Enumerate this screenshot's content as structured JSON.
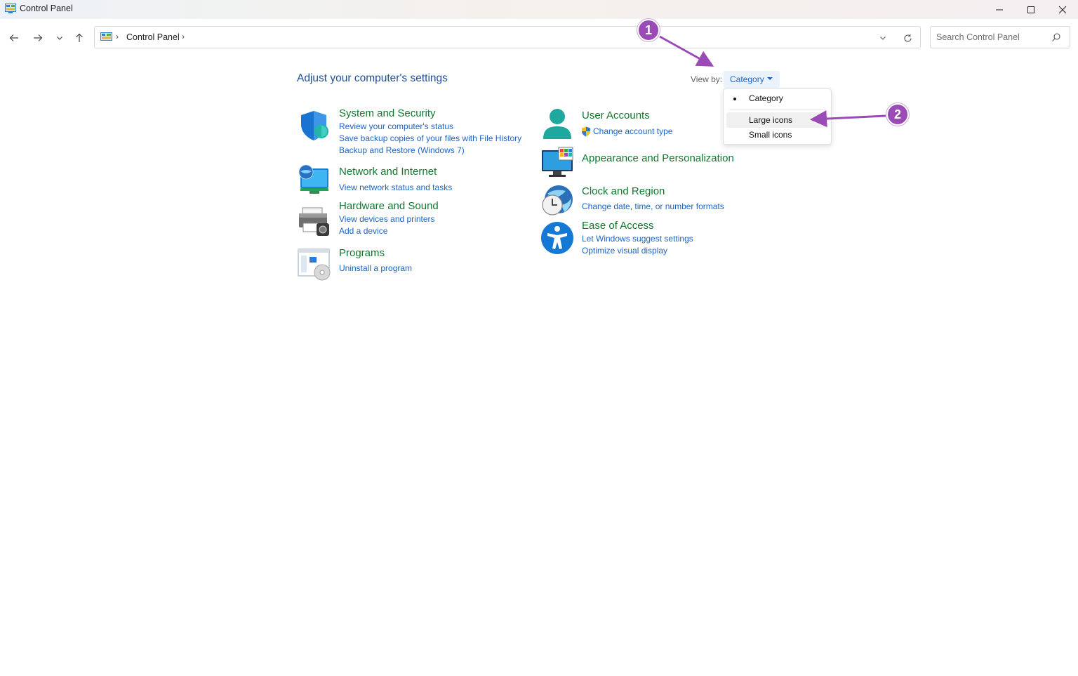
{
  "window": {
    "title": "Control Panel",
    "controls": [
      "minimize-icon",
      "maximize-icon",
      "close-icon"
    ]
  },
  "navigation": {
    "breadcrumb": [
      "Control Panel"
    ],
    "search_placeholder": "Search Control Panel"
  },
  "main": {
    "heading": "Adjust your computer's settings",
    "view_by": {
      "label": "View by:",
      "selected": "Category",
      "options": [
        {
          "label": "Category",
          "selected": true
        },
        {
          "label": "Large icons",
          "selected": false
        },
        {
          "label": "Small icons",
          "selected": false
        }
      ]
    },
    "left_categories": [
      {
        "title": "System and Security",
        "icon": "shield-icon",
        "links": [
          "Review your computer's status",
          "Save backup copies of your files with File History",
          "Backup and Restore (Windows 7)"
        ]
      },
      {
        "title": "Network and Internet",
        "icon": "network-globe-icon",
        "links": [
          "View network status and tasks"
        ]
      },
      {
        "title": "Hardware and Sound",
        "icon": "printer-icon",
        "links": [
          "View devices and printers",
          "Add a device"
        ]
      },
      {
        "title": "Programs",
        "icon": "programs-disc-icon",
        "links": [
          "Uninstall a program"
        ]
      }
    ],
    "right_categories": [
      {
        "title": "User Accounts",
        "icon": "user-icon",
        "links": [
          "Change account type"
        ]
      },
      {
        "title": "Appearance and Personalization",
        "icon": "monitor-palette-icon",
        "links": []
      },
      {
        "title": "Clock and Region",
        "icon": "clock-globe-icon",
        "links": [
          "Change date, time, or number formats"
        ]
      },
      {
        "title": "Ease of Access",
        "icon": "accessibility-icon",
        "links": [
          "Let Windows suggest settings",
          "Optimize visual display"
        ]
      }
    ]
  },
  "annotations": {
    "step_1": "1",
    "step_2": "2",
    "color": "#9b4bb6"
  },
  "colors": {
    "category_title": "#12772d",
    "link": "#1c64c4",
    "heading": "#1f4e9c"
  }
}
